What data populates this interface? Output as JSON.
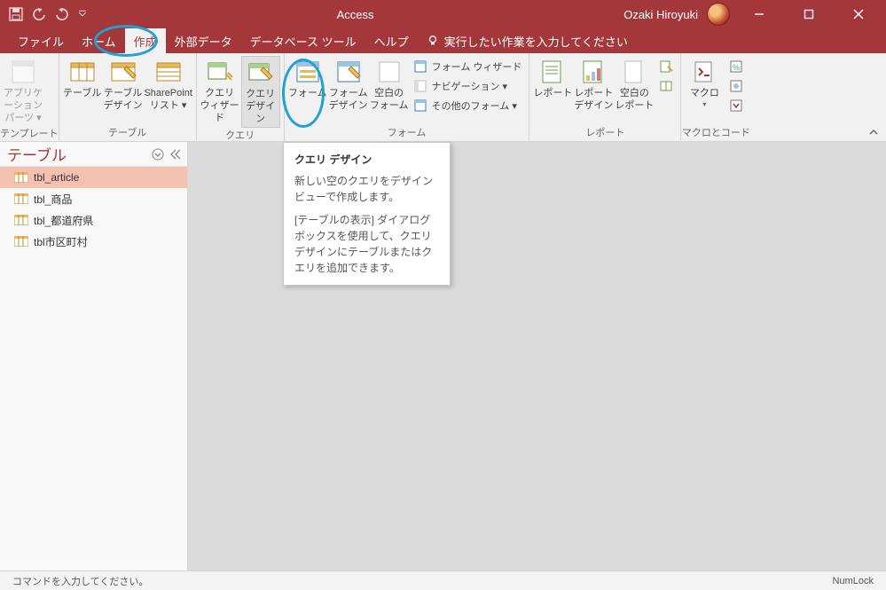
{
  "title": "Access",
  "user": "Ozaki Hiroyuki",
  "tabs": {
    "file": "ファイル",
    "home": "ホーム",
    "create": "作成",
    "external": "外部データ",
    "dbtools": "データベース ツール",
    "help": "ヘルプ",
    "tellme": "実行したい作業を入力してください"
  },
  "ribbon": {
    "group_template": "テンプレート",
    "app_parts": "アプリケーション\nパーツ ▾",
    "group_table": "テーブル",
    "table": "テーブル",
    "table_design": "テーブル\nデザイン",
    "sharepoint": "SharePoint\nリスト ▾",
    "group_query": "クエリ",
    "query_wizard": "クエリ\nウィザード",
    "query_design": "クエリ\nデザイン",
    "group_form": "フォーム",
    "form": "フォーム",
    "form_design": "フォーム\nデザイン",
    "blank_form": "空白の\nフォーム",
    "form_wizard": "フォーム ウィザード",
    "navigation": "ナビゲーション ▾",
    "other_forms": "その他のフォーム ▾",
    "group_report": "レポート",
    "report": "レポート",
    "report_design": "レポート\nデザイン",
    "blank_report": "空白の\nレポート",
    "group_macro": "マクロとコード",
    "macro": "マクロ"
  },
  "nav": {
    "title": "テーブル",
    "items": [
      "tbl_article",
      "tbl_商品",
      "tbl_都道府県",
      "tbl市区町村"
    ]
  },
  "tooltip": {
    "title": "クエリ デザイン",
    "line1": "新しい空のクエリをデザイン ビューで作成します。",
    "line2": "[テーブルの表示] ダイアログ ボックスを使用して、クエリ デザインにテーブルまたはクエリを追加できます。"
  },
  "status": {
    "left": "コマンドを入力してください。",
    "right": "NumLock"
  }
}
